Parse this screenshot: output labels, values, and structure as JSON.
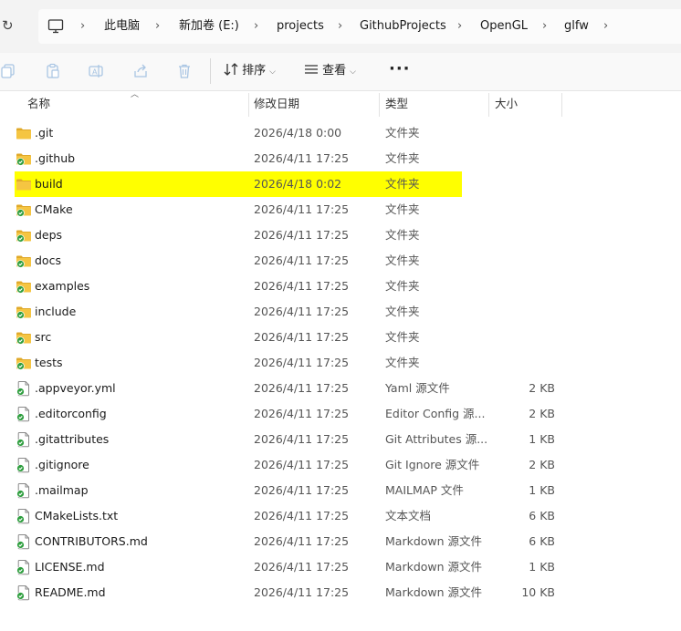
{
  "breadcrumb": {
    "items": [
      "此电脑",
      "新加卷 (E:)",
      "projects",
      "GithubProjects",
      "OpenGL",
      "glfw"
    ],
    "separator": "›"
  },
  "toolbar": {
    "sort_label": "排序",
    "view_label": "查看",
    "more_label": "···"
  },
  "columns": {
    "name": "名称",
    "date": "修改日期",
    "type": "类型",
    "size": "大小"
  },
  "files": [
    {
      "name": ".git",
      "date": "2026/4/18 0:00",
      "type": "文件夹",
      "size": "",
      "kind": "folder"
    },
    {
      "name": ".github",
      "date": "2026/4/11 17:25",
      "type": "文件夹",
      "size": "",
      "kind": "folder-sync"
    },
    {
      "name": "build",
      "date": "2026/4/18 0:02",
      "type": "文件夹",
      "size": "",
      "kind": "folder",
      "selected": true
    },
    {
      "name": "CMake",
      "date": "2026/4/11 17:25",
      "type": "文件夹",
      "size": "",
      "kind": "folder-sync"
    },
    {
      "name": "deps",
      "date": "2026/4/11 17:25",
      "type": "文件夹",
      "size": "",
      "kind": "folder-sync"
    },
    {
      "name": "docs",
      "date": "2026/4/11 17:25",
      "type": "文件夹",
      "size": "",
      "kind": "folder-sync"
    },
    {
      "name": "examples",
      "date": "2026/4/11 17:25",
      "type": "文件夹",
      "size": "",
      "kind": "folder-sync"
    },
    {
      "name": "include",
      "date": "2026/4/11 17:25",
      "type": "文件夹",
      "size": "",
      "kind": "folder-sync"
    },
    {
      "name": "src",
      "date": "2026/4/11 17:25",
      "type": "文件夹",
      "size": "",
      "kind": "folder-sync"
    },
    {
      "name": "tests",
      "date": "2026/4/11 17:25",
      "type": "文件夹",
      "size": "",
      "kind": "folder-sync"
    },
    {
      "name": ".appveyor.yml",
      "date": "2026/4/11 17:25",
      "type": "Yaml 源文件",
      "size": "2 KB",
      "kind": "file-sync"
    },
    {
      "name": ".editorconfig",
      "date": "2026/4/11 17:25",
      "type": "Editor Config 源...",
      "size": "2 KB",
      "kind": "file-sync"
    },
    {
      "name": ".gitattributes",
      "date": "2026/4/11 17:25",
      "type": "Git Attributes 源...",
      "size": "1 KB",
      "kind": "file-sync"
    },
    {
      "name": ".gitignore",
      "date": "2026/4/11 17:25",
      "type": "Git Ignore 源文件",
      "size": "2 KB",
      "kind": "file-sync"
    },
    {
      "name": ".mailmap",
      "date": "2026/4/11 17:25",
      "type": "MAILMAP 文件",
      "size": "1 KB",
      "kind": "file-sync"
    },
    {
      "name": "CMakeLists.txt",
      "date": "2026/4/11 17:25",
      "type": "文本文档",
      "size": "6 KB",
      "kind": "file-sync"
    },
    {
      "name": "CONTRIBUTORS.md",
      "date": "2026/4/11 17:25",
      "type": "Markdown 源文件",
      "size": "6 KB",
      "kind": "file-sync"
    },
    {
      "name": "LICENSE.md",
      "date": "2026/4/11 17:25",
      "type": "Markdown 源文件",
      "size": "1 KB",
      "kind": "file-sync"
    },
    {
      "name": "README.md",
      "date": "2026/4/11 17:25",
      "type": "Markdown 源文件",
      "size": "10 KB",
      "kind": "file-sync"
    }
  ],
  "colors": {
    "folder": "#f5c542",
    "folder_dark": "#e0a92a",
    "sync_green": "#2e9e3e",
    "selection": "#ffff00"
  }
}
